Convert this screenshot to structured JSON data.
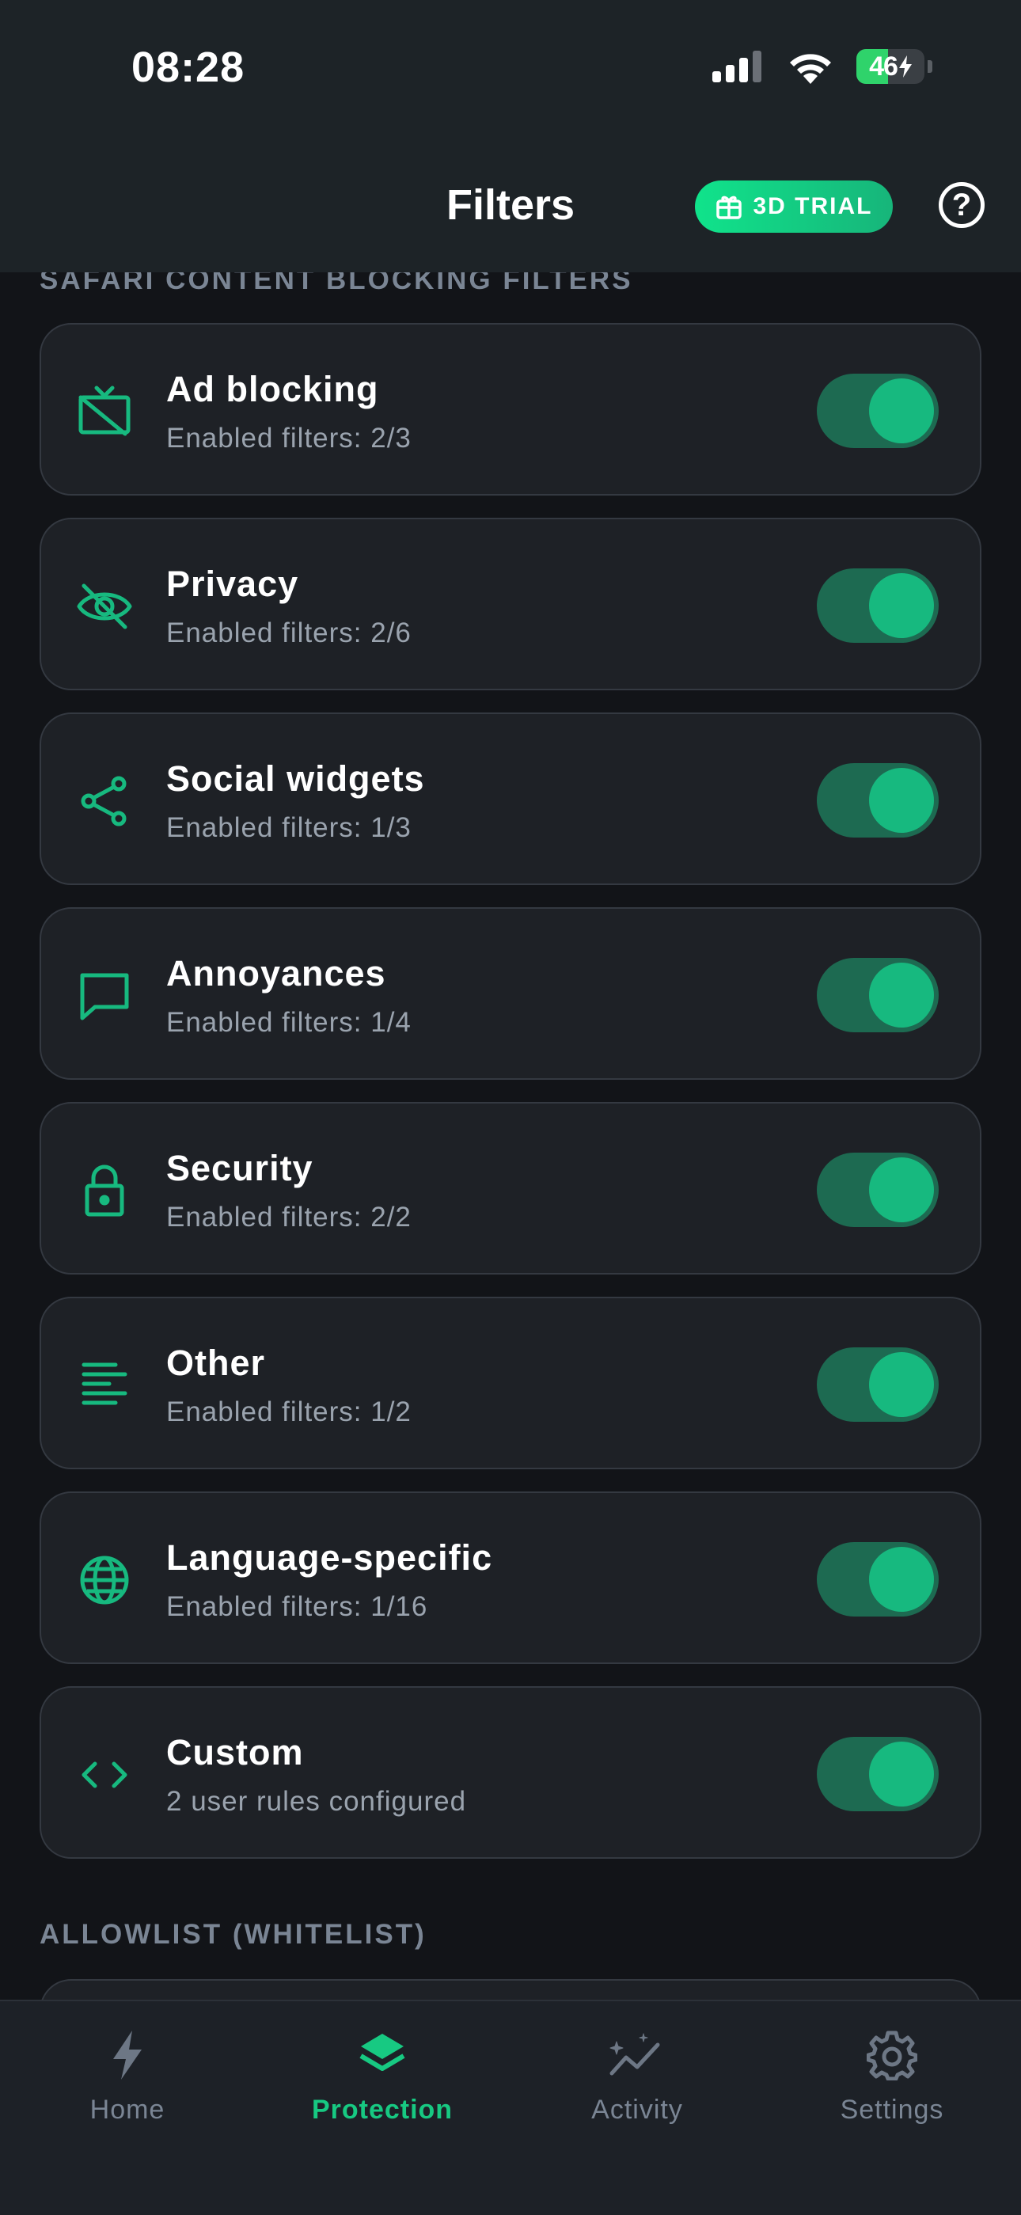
{
  "status": {
    "time": "08:28",
    "battery": "46"
  },
  "header": {
    "title": "Filters",
    "trial_label": "3D TRIAL",
    "help": "?"
  },
  "sections": {
    "safari": "SAFARI CONTENT BLOCKING FILTERS",
    "allowlist": "ALLOWLIST (WHITELIST)"
  },
  "filters": [
    {
      "name": "Ad blocking",
      "sub": "Enabled filters: 2/3",
      "icon": "tv-off-icon",
      "enabled": true
    },
    {
      "name": "Privacy",
      "sub": "Enabled filters: 2/6",
      "icon": "eye-off-icon",
      "enabled": true
    },
    {
      "name": "Social widgets",
      "sub": "Enabled filters: 1/3",
      "icon": "share-icon",
      "enabled": true
    },
    {
      "name": "Annoyances",
      "sub": "Enabled filters: 1/4",
      "icon": "message-square-icon",
      "enabled": true
    },
    {
      "name": "Security",
      "sub": "Enabled filters: 2/2",
      "icon": "lock-icon",
      "enabled": true
    },
    {
      "name": "Other",
      "sub": "Enabled filters: 1/2",
      "icon": "align-left-icon",
      "enabled": true
    },
    {
      "name": "Language-specific",
      "sub": "Enabled filters: 1/16",
      "icon": "globe-icon",
      "enabled": true
    },
    {
      "name": "Custom",
      "sub": "2 user rules configured",
      "icon": "code-icon",
      "enabled": true
    }
  ],
  "tabs": [
    {
      "label": "Home",
      "icon": "bolt-icon",
      "active": false
    },
    {
      "label": "Protection",
      "icon": "layers-icon",
      "active": true
    },
    {
      "label": "Activity",
      "icon": "activity-sparkle-icon",
      "active": false
    },
    {
      "label": "Settings",
      "icon": "gear-icon",
      "active": false
    }
  ],
  "colors": {
    "accent": "#17b97f",
    "toggle_track": "#1d6a51",
    "background": "#121418",
    "card": "#1e2126"
  }
}
